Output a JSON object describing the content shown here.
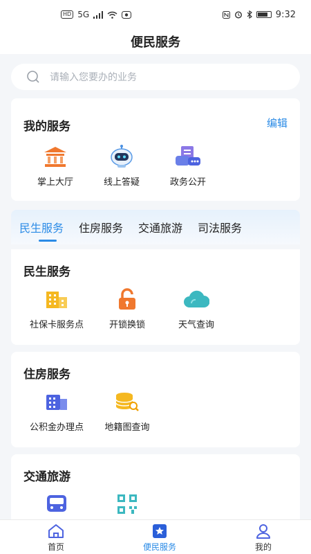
{
  "status_bar": {
    "network": "5G",
    "time": "9:32"
  },
  "header": {
    "title": "便民服务"
  },
  "search": {
    "placeholder": "请输入您要办的业务"
  },
  "my_services": {
    "title": "我的服务",
    "edit_label": "编辑",
    "items": [
      {
        "label": "掌上大厅",
        "icon": "bank-hall-icon"
      },
      {
        "label": "线上答疑",
        "icon": "robot-icon"
      },
      {
        "label": "政务公开",
        "icon": "chat-document-icon"
      }
    ]
  },
  "tabs": [
    {
      "label": "民生服务",
      "active": true
    },
    {
      "label": "住房服务",
      "active": false
    },
    {
      "label": "交通旅游",
      "active": false
    },
    {
      "label": "司法服务",
      "active": false
    }
  ],
  "sections": [
    {
      "title": "民生服务",
      "items": [
        {
          "label": "社保卡服务点",
          "icon": "building-icon"
        },
        {
          "label": "开锁换锁",
          "icon": "lock-icon"
        },
        {
          "label": "天气查询",
          "icon": "cloud-icon"
        }
      ]
    },
    {
      "title": "住房服务",
      "items": [
        {
          "label": "公积金办理点",
          "icon": "office-building-icon"
        },
        {
          "label": "地籍图查询",
          "icon": "database-search-icon"
        }
      ]
    },
    {
      "title": "交通旅游",
      "items": [
        {
          "label": "",
          "icon": "bus-icon"
        },
        {
          "label": "",
          "icon": "qr-code-icon"
        }
      ]
    }
  ],
  "bottom_nav": [
    {
      "label": "首页",
      "icon": "home-icon",
      "active": false
    },
    {
      "label": "便民服务",
      "icon": "star-bookmark-icon",
      "active": true
    },
    {
      "label": "我的",
      "icon": "user-icon",
      "active": false
    }
  ],
  "colors": {
    "accent": "#2b8be6",
    "orange": "#f0782e",
    "yellow": "#f5b820",
    "teal": "#3cb8c0",
    "indigo": "#4d63e0"
  }
}
